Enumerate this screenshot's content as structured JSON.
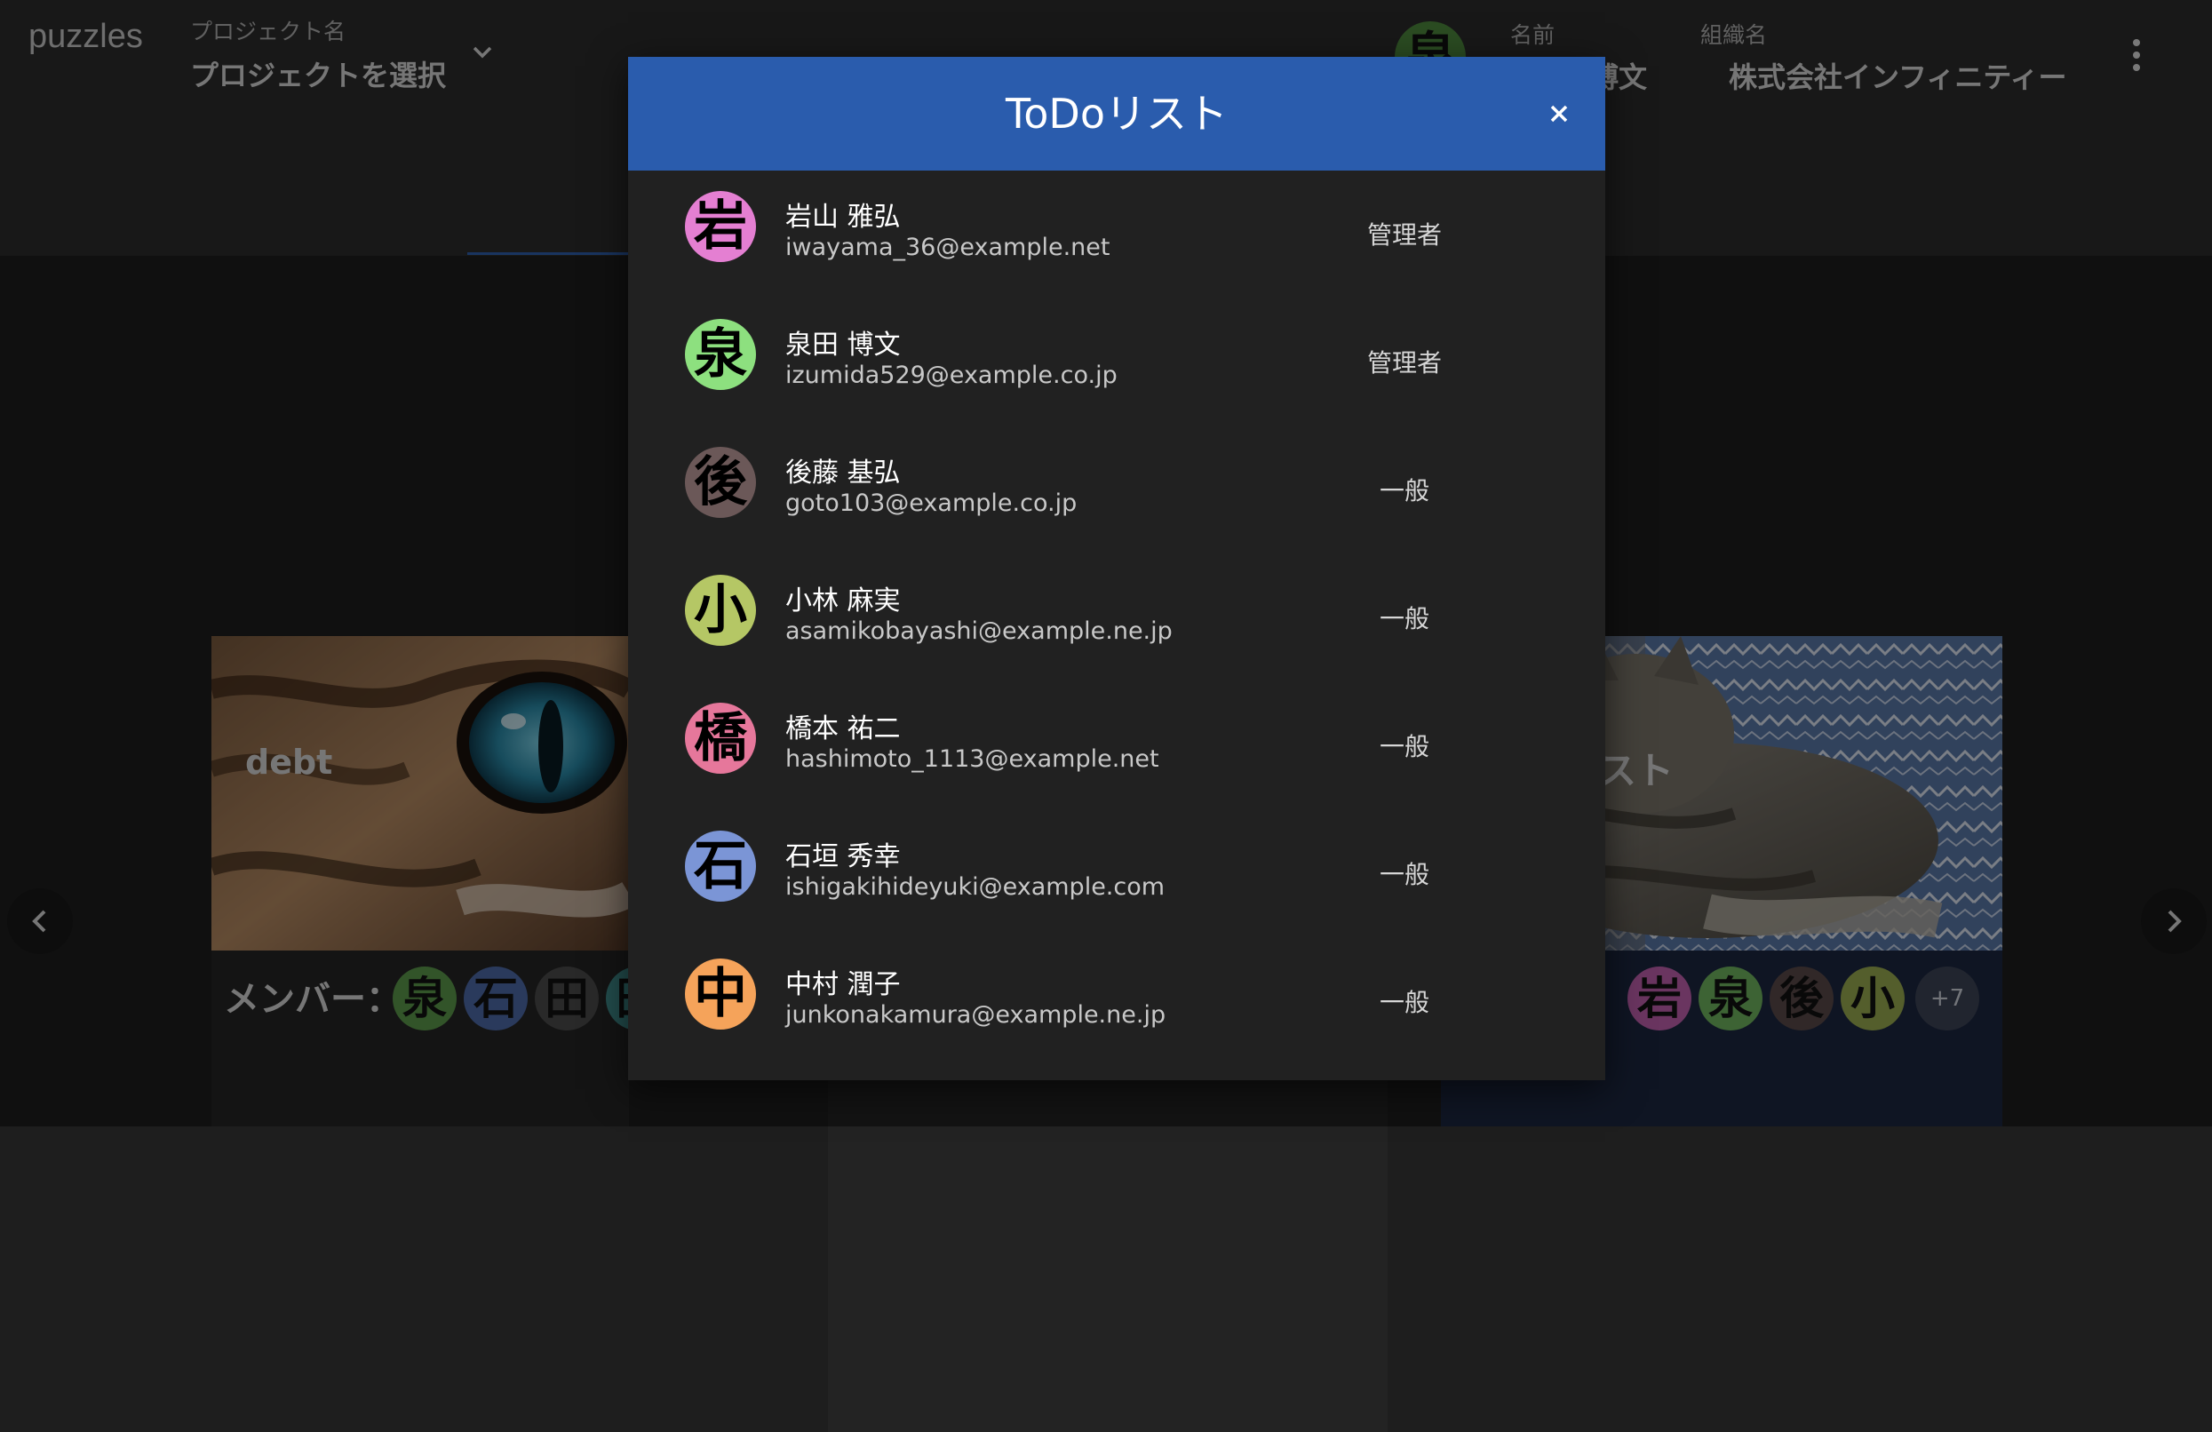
{
  "app": {
    "brand": "puzzles"
  },
  "header": {
    "project_label": "プロジェクト名",
    "project_select": "プロジェクトを選択",
    "user_avatar_char": "泉",
    "name_label": "名前",
    "name_value": "博文",
    "org_label": "組織名",
    "org_value": "株式会社インフィニティー"
  },
  "cards": {
    "left": {
      "title": "debt",
      "members_label": "メンバー：",
      "avatars": [
        "泉",
        "石",
        "田",
        "田"
      ]
    },
    "right": {
      "title_fragment": "スト",
      "members_label": "：",
      "avatars": [
        "岩",
        "泉",
        "後",
        "小"
      ],
      "more": "+7"
    }
  },
  "modal": {
    "title": "ToDoリスト",
    "members": [
      {
        "initial": "岩",
        "name": "岩山 雅弘",
        "email": "iwayama_36@example.net",
        "role": "管理者",
        "color": "#e47fd2"
      },
      {
        "initial": "泉",
        "name": "泉田 博文",
        "email": "izumida529@example.co.jp",
        "role": "管理者",
        "color": "#8de07f"
      },
      {
        "initial": "後",
        "name": "後藤 基弘",
        "email": "goto103@example.co.jp",
        "role": "一般",
        "color": "#6b5858"
      },
      {
        "initial": "小",
        "name": "小林 麻実",
        "email": "asamikobayashi@example.ne.jp",
        "role": "一般",
        "color": "#b5c765"
      },
      {
        "initial": "橋",
        "name": "橋本 祐二",
        "email": "hashimoto_1113@example.net",
        "role": "一般",
        "color": "#e6779b"
      },
      {
        "initial": "石",
        "name": "石垣 秀幸",
        "email": "ishigakihideyuki@example.com",
        "role": "一般",
        "color": "#7b95d6"
      },
      {
        "initial": "中",
        "name": "中村 潤子",
        "email": "junkonakamura@example.ne.jp",
        "role": "一般",
        "color": "#f5a35a"
      }
    ]
  }
}
